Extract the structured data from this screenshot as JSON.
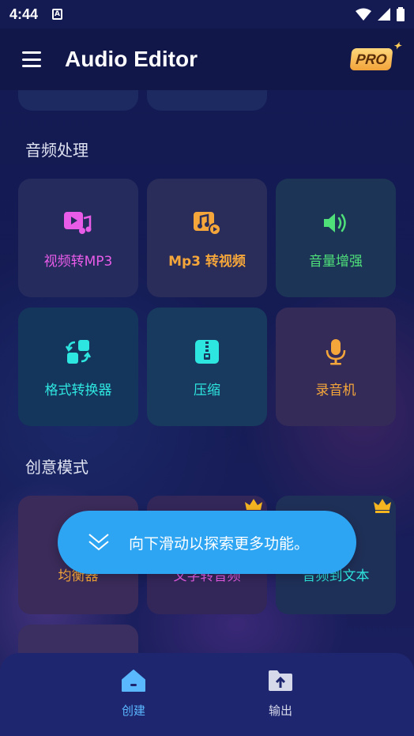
{
  "status_bar": {
    "time": "4:44",
    "notif_letter": "A"
  },
  "app_bar": {
    "title": "Audio Editor",
    "pro_label": "PRO"
  },
  "sections": {
    "audio_processing": "音频处理",
    "creative_mode": "创意模式"
  },
  "audio_cards": [
    {
      "label": "视频转MP3",
      "icon": "video-music-icon",
      "color": "#e85ce8"
    },
    {
      "label": "Mp3 转视频",
      "icon": "music-to-video-icon",
      "color": "#f5a63a"
    },
    {
      "label": "音量增强",
      "icon": "volume-icon",
      "color": "#4fe07a"
    },
    {
      "label": "格式转换器",
      "icon": "format-convert-icon",
      "color": "#2ee6e0"
    },
    {
      "label": "压缩",
      "icon": "zip-icon",
      "color": "#2ee6e0"
    },
    {
      "label": "录音机",
      "icon": "microphone-icon",
      "color": "#f5a63a"
    }
  ],
  "creative_cards": [
    {
      "label": "均衡器",
      "color": "#f5a63a",
      "premium": false
    },
    {
      "label": "文字转音频",
      "color": "#e85ce8",
      "premium": true
    },
    {
      "label": "音频到文本",
      "color": "#2ee6e0",
      "premium": true
    }
  ],
  "toast": {
    "text": "向下滑动以探索更多功能。"
  },
  "bottom_nav": [
    {
      "label": "创建",
      "icon": "home-icon",
      "active": true
    },
    {
      "label": "输出",
      "icon": "folder-upload-icon",
      "active": false
    }
  ],
  "colors": {
    "active_nav": "#5ab8ff",
    "inactive_nav": "#d6d9ea",
    "crown": "#f5b521"
  }
}
